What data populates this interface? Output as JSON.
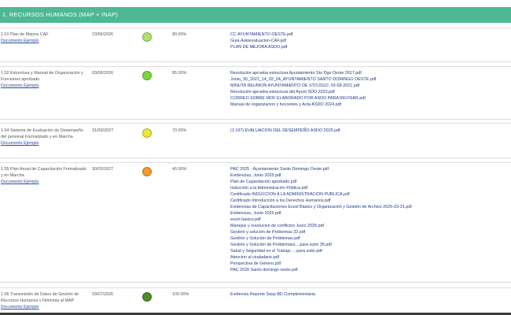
{
  "section": {
    "title": "1. RECURSOS HUMANOS (MAP + INAP)"
  },
  "rows": [
    {
      "name": "1.01 Plan de Mejora CAF",
      "link": "Documento Ejemplo",
      "date": "23/06/2026",
      "status_color": "#a9e36d",
      "percent": "80.00%",
      "docs": [
        "CC AYUNTAMIENTO OESTE.pdf",
        "Guia-Autoevaluacion-CAF.pdf",
        "PLAN DE MEJORA ASDO.pdf"
      ]
    },
    {
      "name": "1.02 Estructura y Manual de Organización y Funciones aprobado",
      "link": "Documento Ejemplo",
      "date": "03/06/2026",
      "status_color": "#7bd73f",
      "percent": "85.00%",
      "docs": [
        "Resolución aprueba estructura Ayuntamiento Sto Dgo Oeste 2017.pdf",
        "Junio_30_2021_14_02_04_AYUNTAMIENTO SANTO DOMINGO OESTE.pdf",
        "MINUTA REUNION AYUNTAMIENTO DE STO.DGO. 03-08-2021.pdf",
        "Resolución aprueba estructura del Ayunt SDO 2023.pdf",
        "CORREO SOBRE MOF ELABORADO POR ASDO PARA REVISAR.pdf",
        "Manual de organizacion y funciones y Acta ASDO 2024.pdf"
      ]
    },
    {
      "name": "1.04 Sistema de Evaluación de Desempeño del personal Formalizado y en Marcha",
      "link": "Documento Ejemplo",
      "date": "31/03/2027",
      "status_color": "#e8e83a",
      "percent": "70.00%",
      "docs": [
        "(1.197) EVALUACION DEL DESEMPEÑO ASDO 2025.pdf"
      ]
    },
    {
      "name": "1.05 Plan Anual de Capacitación Formalizado y en Marcha",
      "link": "Documento Ejemplo",
      "date": "30/03/2027",
      "status_color": "#f29a2e",
      "percent": "40.00%",
      "docs": [
        "PAC 2025 - Ayuntamiento Santo Domingo Oeste.pdf",
        "Evidencias, Junio 2025.pdf",
        "Plan de Capacitación aprobado.pdf",
        "Inducción a la Administración Pública.pdf",
        "Certificado INDUCCION A LA ADMINISTRACION PUBLICA.pdf",
        "Certificado Introducción a los Derechos Humanos.pdf",
        "Evidencias de Capacitaciones Excel Básico y Organización y Gestión de Archivo 2025-03-31.pdf",
        "Evidencias, Junio 2025.pdf",
        "excel basico.pdf",
        "Manejos y resolucion de conflictos Junio 2025.pdf",
        "Gestión y solución de Problemas 32.pdf",
        "Gestión y Solución de Problemas.pdf",
        "Gestión y Solución de Problemass....para subir 35.pdf",
        "Salud y Seguridad en el Trabajo ....para subir.pdf",
        "Atencion al ciudadano.pdf",
        "Perspectiva de Género.pdf",
        "PAC 2026 Santo domingo oeste.pdf"
      ]
    },
    {
      "name": "1.06 Transmisión de Datos de Gestión de Recursos Humanos y Nóminas al MAP",
      "link": "Documento Ejemplo",
      "date": "03/07/2026",
      "status_color": "#4f8a2b",
      "percent": "100.00%",
      "docs": [
        "Evidencia Reporte Sasp BD Complementaria"
      ]
    }
  ]
}
